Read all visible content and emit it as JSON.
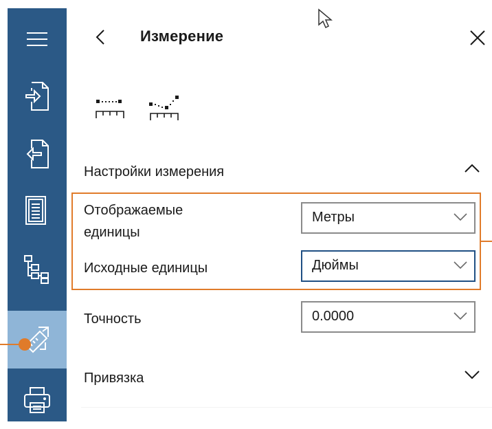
{
  "panel": {
    "title": "Измерение"
  },
  "rail": {
    "items": [
      {
        "name": "menu-icon"
      },
      {
        "name": "import-icon"
      },
      {
        "name": "export-icon"
      },
      {
        "name": "document-icon"
      },
      {
        "name": "hierarchy-icon"
      },
      {
        "name": "measure-icon",
        "active": true
      },
      {
        "name": "print-icon"
      }
    ]
  },
  "tools": [
    {
      "name": "measure-distance-icon"
    },
    {
      "name": "measure-multipoint-icon"
    }
  ],
  "settings": {
    "header": "Настройки измерения",
    "expanded": true,
    "display_units": {
      "label_line1": "Отображаемые",
      "label_line2": "единицы",
      "value": "Метры"
    },
    "source_units": {
      "label": "Исходные единицы",
      "value": "Дюймы"
    },
    "precision": {
      "label": "Точность",
      "value": "0.0000"
    }
  },
  "snap": {
    "header": "Привязка",
    "expanded": false
  },
  "colors": {
    "rail": "#2b5986",
    "rail_active": "#8fb5d7",
    "highlight": "#e07b2a",
    "focus_border": "#1f4f83"
  }
}
